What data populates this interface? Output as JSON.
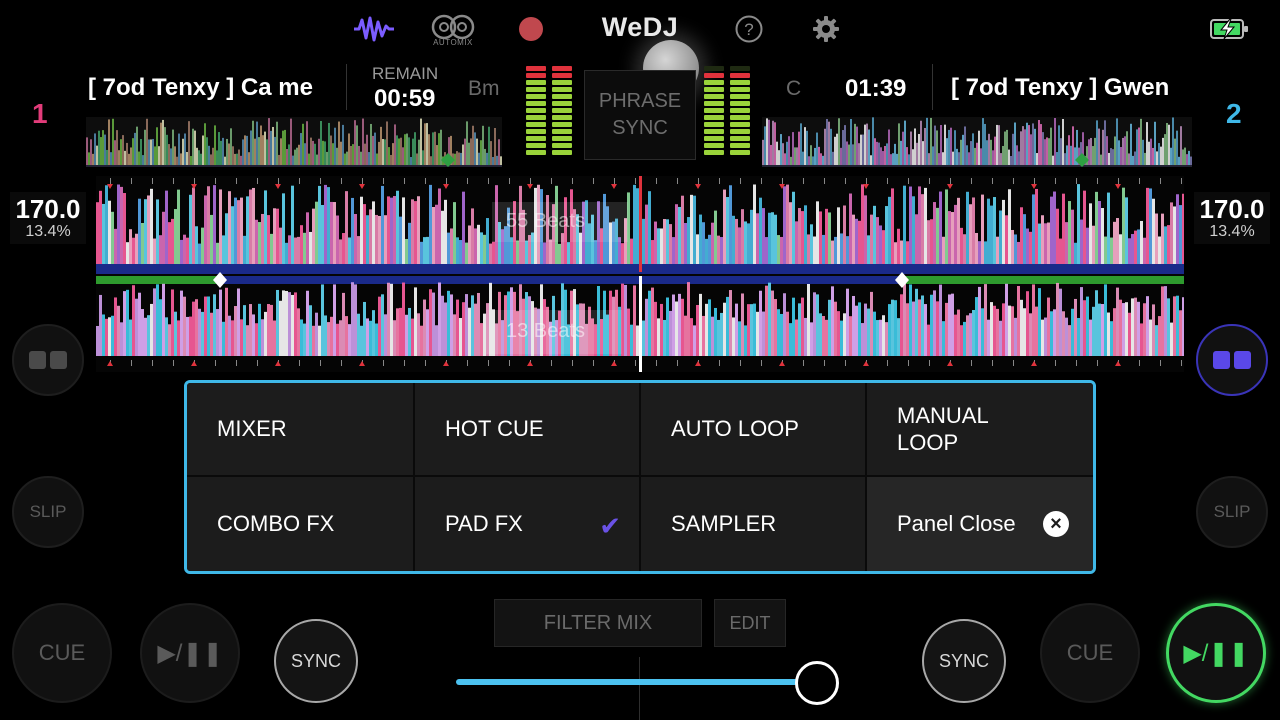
{
  "app": {
    "logo": "WeDJ"
  },
  "topbar": {
    "icons": [
      "waveform-icon",
      "automix-icon",
      "record-icon",
      "help-icon",
      "settings-icon",
      "battery-charging-icon"
    ],
    "automix_label": "AUTOMIX",
    "record_color": "#c0484e",
    "waveform_icon_color": "#7b5cff"
  },
  "deck1": {
    "number": "1",
    "number_color": "#e23c7a",
    "title": "[ 7od Tenxy ] Ca me",
    "remain_label": "REMAIN",
    "remain_time": "00:59",
    "key": "Bm",
    "bpm": "170.0",
    "pitch": "13.4%",
    "beats_label": "55 Beats"
  },
  "deck2": {
    "number": "2",
    "number_color": "#3fb8e8",
    "title": "[ 7od Tenxy ] Gwen",
    "time": "01:39",
    "key": "C",
    "bpm": "170.0",
    "pitch": "13.4%",
    "beats_label": "13 Beats"
  },
  "center": {
    "phrase_sync_line1": "PHRASE",
    "phrase_sync_line2": "SYNC"
  },
  "side": {
    "slip_left": "SLIP",
    "slip_right": "SLIP"
  },
  "panel": {
    "row1": [
      "MIXER",
      "HOT CUE",
      "AUTO LOOP",
      "MANUAL\nLOOP"
    ],
    "row2": [
      "COMBO FX",
      "PAD FX",
      "SAMPLER",
      "Panel Close"
    ],
    "checked_item": "PAD FX",
    "border_color": "#3fb8e8",
    "check_color": "#6a52e6"
  },
  "bottom": {
    "cue_left": "CUE",
    "play_left": "▶/❚❚",
    "sync_left": "SYNC",
    "filter_mix": "FILTER MIX",
    "edit": "EDIT",
    "sync_right": "SYNC",
    "cue_right": "CUE",
    "play_right": "▶/❚❚",
    "play_active_color": "#43d862",
    "crossfader_position": 0.82
  }
}
